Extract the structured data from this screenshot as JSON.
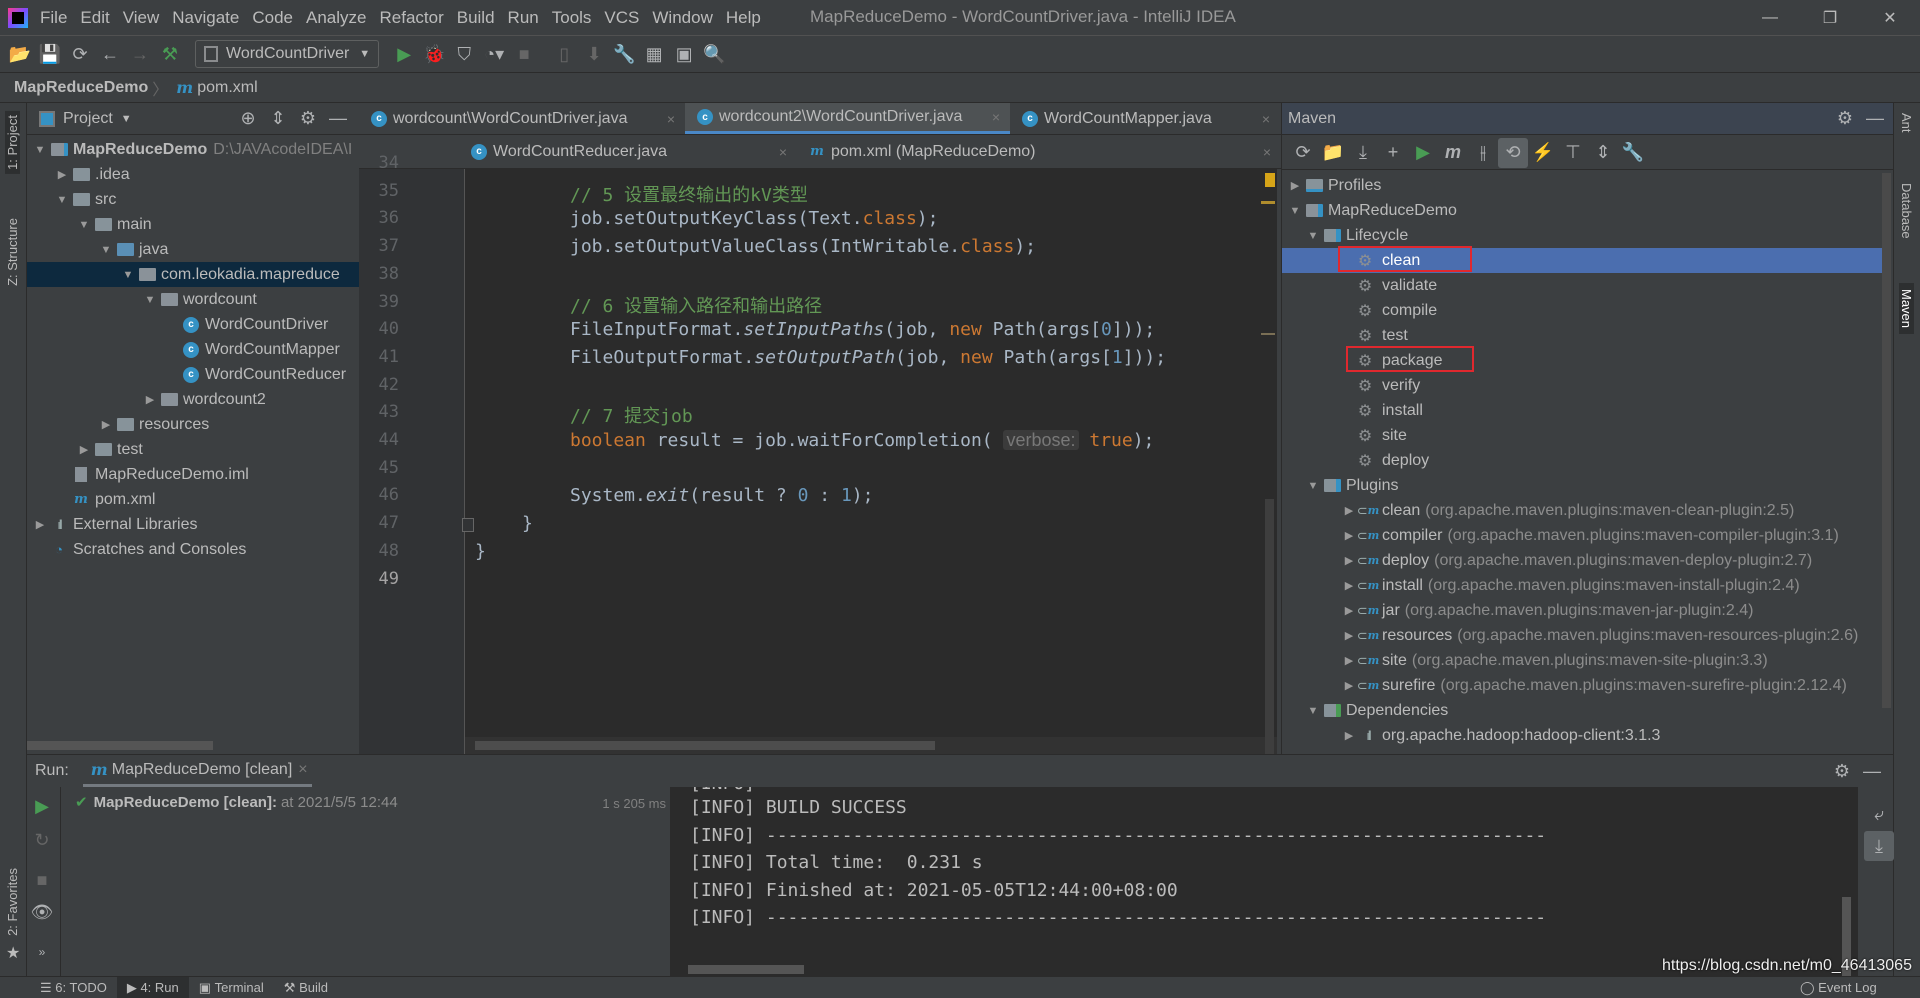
{
  "window": {
    "title": "MapReduceDemo - WordCountDriver.java - IntelliJ IDEA"
  },
  "menu": [
    "File",
    "Edit",
    "View",
    "Navigate",
    "Code",
    "Analyze",
    "Refactor",
    "Build",
    "Run",
    "Tools",
    "VCS",
    "Window",
    "Help"
  ],
  "toolbar": {
    "run_config": "WordCountDriver"
  },
  "breadcrumb": {
    "project": "MapReduceDemo",
    "file": "pom.xml"
  },
  "left_stripe": {
    "project": "1: Project",
    "structure": "Z: Structure",
    "favorites": "2: Favorites"
  },
  "project": {
    "header": "Project",
    "tree": [
      {
        "label": "MapReduceDemo",
        "extra": "D:\\JAVAcodeIDEA\\I",
        "level": 0,
        "arrow": "down",
        "icon": "module",
        "bold": true
      },
      {
        "label": ".idea",
        "level": 1,
        "arrow": "right",
        "icon": "folder"
      },
      {
        "label": "src",
        "level": 1,
        "arrow": "down",
        "icon": "folder"
      },
      {
        "label": "main",
        "level": 2,
        "arrow": "down",
        "icon": "folder"
      },
      {
        "label": "java",
        "level": 3,
        "arrow": "down",
        "icon": "folder-blue"
      },
      {
        "label": "com.leokadia.mapreduce",
        "level": 4,
        "arrow": "down",
        "icon": "package",
        "selected": true
      },
      {
        "label": "wordcount",
        "level": 5,
        "arrow": "down",
        "icon": "package"
      },
      {
        "label": "WordCountDriver",
        "level": 6,
        "icon": "class"
      },
      {
        "label": "WordCountMapper",
        "level": 6,
        "icon": "class"
      },
      {
        "label": "WordCountReducer",
        "level": 6,
        "icon": "class"
      },
      {
        "label": "wordcount2",
        "level": 5,
        "arrow": "right",
        "icon": "package"
      },
      {
        "label": "resources",
        "level": 3,
        "arrow": "right",
        "icon": "folder"
      },
      {
        "label": "test",
        "level": 2,
        "arrow": "right",
        "icon": "folder"
      },
      {
        "label": "MapReduceDemo.iml",
        "level": 1,
        "icon": "iml"
      },
      {
        "label": "pom.xml",
        "level": 1,
        "icon": "maven"
      },
      {
        "label": "External Libraries",
        "level": 0,
        "arrow": "right",
        "icon": "library"
      },
      {
        "label": "Scratches and Consoles",
        "level": 0,
        "icon": "scratches"
      }
    ]
  },
  "editor": {
    "tabs_row1": [
      {
        "label": "wordcount\\WordCountDriver.java",
        "icon": "class"
      },
      {
        "label": "wordcount2\\WordCountDriver.java",
        "icon": "class",
        "active": true
      },
      {
        "label": "WordCountMapper.java",
        "icon": "class"
      }
    ],
    "tabs_row2": [
      {
        "label": "WordCountReducer.java",
        "icon": "class"
      },
      {
        "label": "pom.xml (MapReduceDemo)",
        "icon": "maven"
      }
    ],
    "line_numbers": [
      "34",
      "35",
      "36",
      "37",
      "38",
      "39",
      "40",
      "41",
      "42",
      "43",
      "44",
      "45",
      "46",
      "47",
      "48",
      "49"
    ],
    "lines": [
      [],
      [
        [
          "cm",
          "// 5 设置最终输出的kV类型"
        ]
      ],
      [
        [
          "p",
          "job.setOutputKeyClass(Text."
        ],
        [
          "kw",
          "class"
        ],
        [
          "p",
          ");"
        ]
      ],
      [
        [
          "p",
          "job.setOutputValueClass(IntWritable."
        ],
        [
          "kw",
          "class"
        ],
        [
          "p",
          ");"
        ]
      ],
      [],
      [
        [
          "cm",
          "// 6 设置输入路径和输出路径"
        ]
      ],
      [
        [
          "p",
          "FileInputFormat."
        ],
        [
          "it",
          "setInputPaths"
        ],
        [
          "p",
          "(job, "
        ],
        [
          "kw",
          "new "
        ],
        [
          "p",
          "Path(args["
        ],
        [
          "num",
          "0"
        ],
        [
          "p",
          "]));"
        ]
      ],
      [
        [
          "p",
          "FileOutputFormat."
        ],
        [
          "it",
          "setOutputPath"
        ],
        [
          "p",
          "(job, "
        ],
        [
          "kw",
          "new "
        ],
        [
          "p",
          "Path(args["
        ],
        [
          "num",
          "1"
        ],
        [
          "p",
          "]));"
        ]
      ],
      [],
      [
        [
          "cm",
          "// 7 提交job"
        ]
      ],
      [
        [
          "kw",
          "boolean "
        ],
        [
          "p",
          "result = job.waitForCompletion( "
        ],
        [
          "hint",
          "verbose:"
        ],
        [
          "kw",
          " true"
        ],
        [
          "p",
          ");"
        ]
      ],
      [],
      [
        [
          "p",
          "System."
        ],
        [
          "it",
          "exit"
        ],
        [
          "p",
          "(result ? "
        ],
        [
          "num",
          "0"
        ],
        [
          "p",
          " : "
        ],
        [
          "num",
          "1"
        ],
        [
          "p",
          ");"
        ]
      ],
      [
        [
          "p",
          "}"
        ]
      ],
      [
        [
          "p",
          "}"
        ]
      ],
      []
    ]
  },
  "maven": {
    "title": "Maven",
    "tree": [
      {
        "label": "Profiles",
        "arrow": "right",
        "level": 0,
        "icon": "profiles"
      },
      {
        "label": "MapReduceDemo",
        "arrow": "down",
        "level": 0,
        "icon": "maven-module"
      },
      {
        "label": "Lifecycle",
        "arrow": "down",
        "level": 1,
        "icon": "lifecycle-folder"
      },
      {
        "label": "clean",
        "level": 2,
        "icon": "gear",
        "selected": true,
        "highlighted": true
      },
      {
        "label": "validate",
        "level": 2,
        "icon": "gear"
      },
      {
        "label": "compile",
        "level": 2,
        "icon": "gear"
      },
      {
        "label": "test",
        "level": 2,
        "icon": "gear"
      },
      {
        "label": "package",
        "level": 2,
        "icon": "gear",
        "highlighted": true
      },
      {
        "label": "verify",
        "level": 2,
        "icon": "gear"
      },
      {
        "label": "install",
        "level": 2,
        "icon": "gear"
      },
      {
        "label": "site",
        "level": 2,
        "icon": "gear"
      },
      {
        "label": "deploy",
        "level": 2,
        "icon": "gear"
      },
      {
        "label": "Plugins",
        "arrow": "down",
        "level": 1,
        "icon": "plugins-folder"
      },
      {
        "label": "clean",
        "extra": "(org.apache.maven.plugins:maven-clean-plugin:2.5)",
        "arrow": "right",
        "level": 2,
        "icon": "plugin"
      },
      {
        "label": "compiler",
        "extra": "(org.apache.maven.plugins:maven-compiler-plugin:3.1)",
        "arrow": "right",
        "level": 2,
        "icon": "plugin"
      },
      {
        "label": "deploy",
        "extra": "(org.apache.maven.plugins:maven-deploy-plugin:2.7)",
        "arrow": "right",
        "level": 2,
        "icon": "plugin"
      },
      {
        "label": "install",
        "extra": "(org.apache.maven.plugins:maven-install-plugin:2.4)",
        "arrow": "right",
        "level": 2,
        "icon": "plugin"
      },
      {
        "label": "jar",
        "extra": "(org.apache.maven.plugins:maven-jar-plugin:2.4)",
        "arrow": "right",
        "level": 2,
        "icon": "plugin"
      },
      {
        "label": "resources",
        "extra": "(org.apache.maven.plugins:maven-resources-plugin:2.6)",
        "arrow": "right",
        "level": 2,
        "icon": "plugin"
      },
      {
        "label": "site",
        "extra": "(org.apache.maven.plugins:maven-site-plugin:3.3)",
        "arrow": "right",
        "level": 2,
        "icon": "plugin"
      },
      {
        "label": "surefire",
        "extra": "(org.apache.maven.plugins:maven-surefire-plugin:2.12.4)",
        "arrow": "right",
        "level": 2,
        "icon": "plugin"
      },
      {
        "label": "Dependencies",
        "arrow": "down",
        "level": 1,
        "icon": "dependencies-folder"
      },
      {
        "label": "org.apache.hadoop:hadoop-client:3.1.3",
        "arrow": "right",
        "level": 2,
        "icon": "library"
      }
    ]
  },
  "right_stripe": {
    "ant": "Ant",
    "database": "Database",
    "maven": "Maven"
  },
  "run": {
    "label": "Run:",
    "tab": "MapReduceDemo [clean]",
    "result_title": "MapReduceDemo [clean]:",
    "result_time": "at 2021/5/5 12:44",
    "duration": "1 s 205 ms",
    "console": [
      "[INFO] BUILD SUCCESS",
      "[INFO] ------------------------------------------------------------------------",
      "[INFO] Total time:  0.231 s",
      "[INFO] Finished at: 2021-05-05T12:44:00+08:00",
      "[INFO] ------------------------------------------------------------------------"
    ]
  },
  "statusbar": {
    "todo": "6: TODO",
    "run": "4: Run",
    "terminal": "Terminal",
    "build": "Build",
    "watermark": "https://blog.csdn.net/m0_46413065",
    "event_log": "Event Log"
  },
  "colors": {
    "selection": "#4b6eaf",
    "highlight_box": "#e0282e",
    "run_green": "#499c54",
    "accent": "#3592c4"
  }
}
